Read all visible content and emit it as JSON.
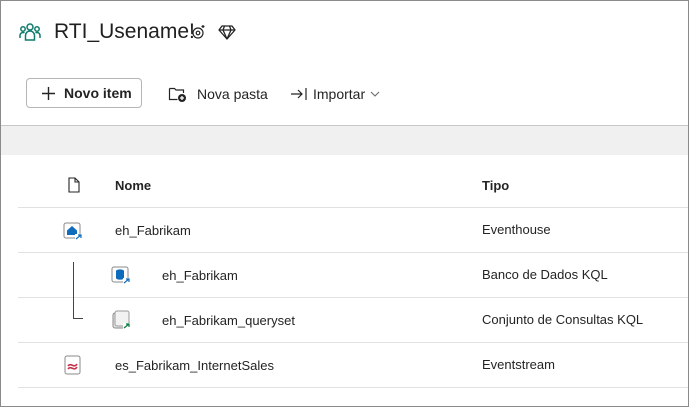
{
  "header": {
    "workspace_title": "RTI_Usename!",
    "icons": [
      "workspace-people-icon",
      "settings-sparkle-icon",
      "diamond-icon"
    ]
  },
  "toolbar": {
    "new_item_label": "Novo item",
    "new_folder_label": "Nova pasta",
    "import_label": "Importar"
  },
  "table": {
    "columns": {
      "name": "Nome",
      "type": "Tipo"
    },
    "rows": [
      {
        "name": "eh_Fabrikam",
        "type": "Eventhouse",
        "icon": "eventhouse-icon",
        "indent": 0
      },
      {
        "name": "eh_Fabrikam",
        "type": "Banco de Dados KQL",
        "icon": "kql-database-icon",
        "indent": 1
      },
      {
        "name": "eh_Fabrikam_queryset",
        "type": "Conjunto de Consultas KQL",
        "icon": "kql-queryset-icon",
        "indent": 1
      },
      {
        "name": "es_Fabrikam_InternetSales",
        "type": "Eventstream",
        "icon": "eventstream-icon",
        "indent": 0
      }
    ]
  },
  "colors": {
    "accent_teal": "#0f7b6c",
    "eventhouse_blue": "#0f6cbd",
    "eventstream_pink": "#c4314b",
    "toolbar_separator": "#c8c8c8",
    "band_gray": "#f0f0f0"
  }
}
